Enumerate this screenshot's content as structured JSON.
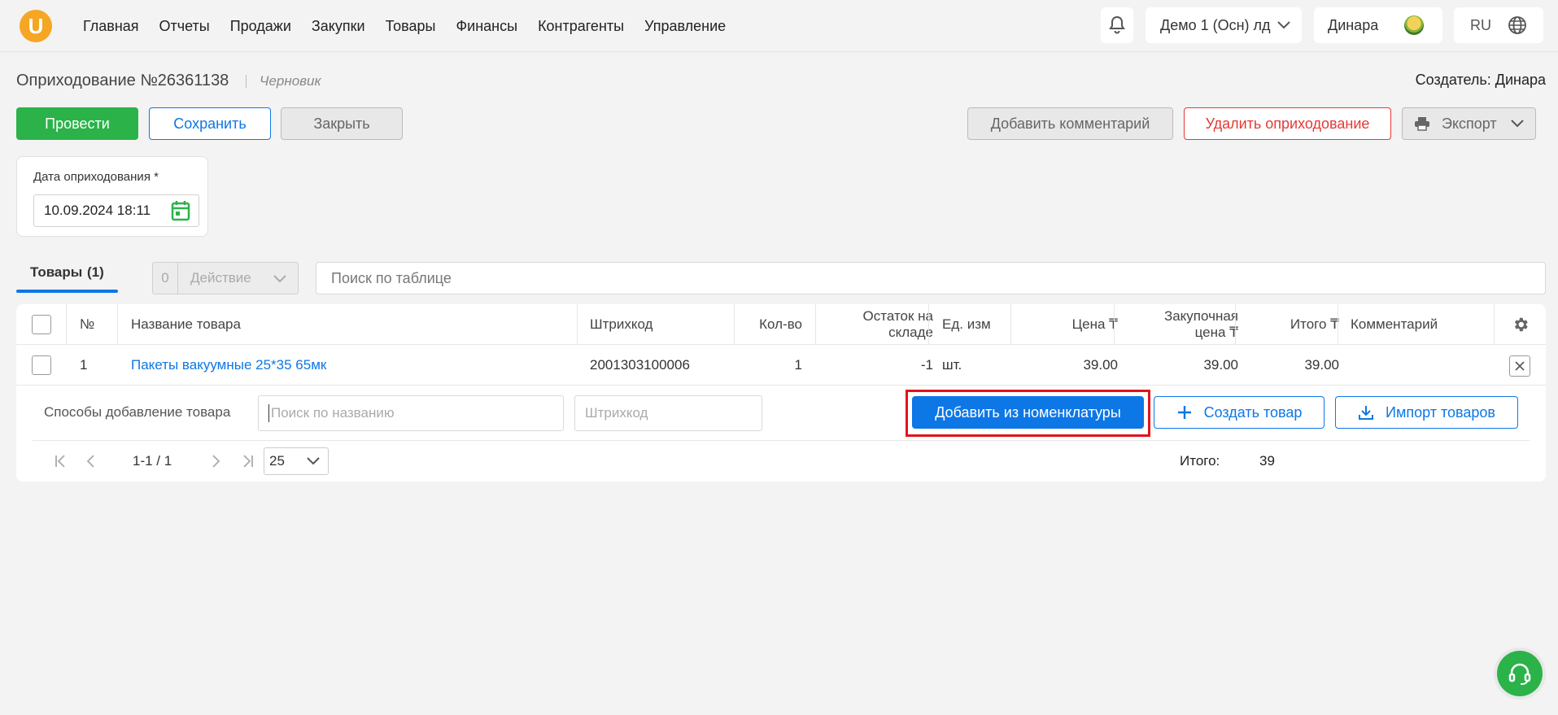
{
  "nav": {
    "logo_letter": "U",
    "items": [
      "Главная",
      "Отчеты",
      "Продажи",
      "Закупки",
      "Товары",
      "Финансы",
      "Контрагенты",
      "Управление"
    ],
    "company": "Демо 1 (Осн) лд",
    "user": "Динара",
    "lang": "RU"
  },
  "header": {
    "title": "Оприходование №26361138",
    "status": "Черновик",
    "creator": "Создатель: Динара"
  },
  "toolbar": {
    "conduct": "Провести",
    "save": "Сохранить",
    "close": "Закрыть",
    "add_comment": "Добавить комментарий",
    "delete": "Удалить оприходование",
    "export": "Экспорт"
  },
  "date_field": {
    "label": "Дата оприходования *",
    "value": "10.09.2024 18:11"
  },
  "tabs": {
    "goods_label": "Товары",
    "goods_count": "(1)"
  },
  "actions": {
    "selected_count": "0",
    "action_label": "Действие",
    "search_placeholder": "Поиск по таблице"
  },
  "table": {
    "headers": {
      "num": "№",
      "name": "Название товара",
      "barcode": "Штрихкод",
      "qty": "Кол-во",
      "stock_1": "Остаток на",
      "stock_2": "складе",
      "unit": "Ед. изм",
      "price": "Цена ₸",
      "purchase_1": "Закупочная",
      "purchase_2": "цена ₸",
      "total": "Итого ₸",
      "comment": "Комментарий"
    },
    "rows": [
      {
        "num": "1",
        "name": "Пакеты вакуумные 25*35 65мк",
        "barcode": "2001303100006",
        "qty": "1",
        "stock": "-1",
        "unit": "шт.",
        "price": "39.00",
        "purchase": "39.00",
        "total": "39.00",
        "comment": ""
      }
    ]
  },
  "add_row": {
    "label": "Способы добавление товара",
    "name_placeholder": "Поиск по названию",
    "barcode_placeholder": "Штрихкод",
    "add_from_catalog": "Добавить из номенклатуры",
    "create": "Создать товар",
    "import": "Импорт товаров"
  },
  "pagination": {
    "range": "1-1 / 1",
    "page_size": "25",
    "total_label": "Итого:",
    "total_value": "39"
  },
  "colors": {
    "primary": "#0d77e6",
    "success": "#2bb34a",
    "danger": "#e53935",
    "highlight": "#e3131b"
  }
}
